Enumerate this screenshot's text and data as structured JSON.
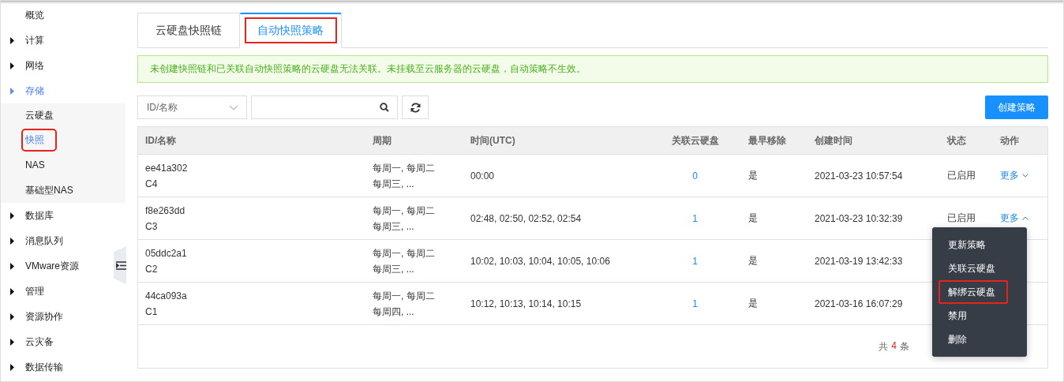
{
  "sidebar": {
    "items": [
      {
        "label": "概览",
        "has_arrow": false,
        "expanded": false
      },
      {
        "label": "计算",
        "has_arrow": true,
        "expanded": false
      },
      {
        "label": "网络",
        "has_arrow": true,
        "expanded": false
      },
      {
        "label": "存储",
        "has_arrow": true,
        "expanded": true,
        "children": [
          {
            "label": "云硬盘",
            "selected": false,
            "highlighted": false
          },
          {
            "label": "快照",
            "selected": true,
            "highlighted": true
          },
          {
            "label": "NAS",
            "selected": false,
            "highlighted": false
          },
          {
            "label": "基础型NAS",
            "selected": false,
            "highlighted": false
          }
        ]
      },
      {
        "label": "数据库",
        "has_arrow": true,
        "expanded": false
      },
      {
        "label": "消息队列",
        "has_arrow": true,
        "expanded": false
      },
      {
        "label": "VMware资源",
        "has_arrow": true,
        "expanded": false
      },
      {
        "label": "管理",
        "has_arrow": true,
        "expanded": false
      },
      {
        "label": "资源协作",
        "has_arrow": true,
        "expanded": false
      },
      {
        "label": "云灾备",
        "has_arrow": true,
        "expanded": false
      },
      {
        "label": "数据传输",
        "has_arrow": true,
        "expanded": false
      }
    ]
  },
  "tabs": [
    {
      "label": "云硬盘快照链",
      "selected": false,
      "highlighted": false
    },
    {
      "label": "自动快照策略",
      "selected": true,
      "highlighted": true
    }
  ],
  "alert": {
    "text": "未创建快照链和已关联自动快照策略的云硬盘无法关联。未挂载至云服务器的云硬盘，自动策略不生效。"
  },
  "toolbar": {
    "filter_select": "ID/名称",
    "create_button": "创建策略"
  },
  "table": {
    "columns": [
      "ID/名称",
      "周期",
      "时间(UTC)",
      "关联云硬盘",
      "最早移除",
      "创建时间",
      "状态",
      "动作"
    ],
    "rows": [
      {
        "id": "ee41a302",
        "name": "C4",
        "period": [
          "每周一, 每周二",
          "每周三, ..."
        ],
        "time": "00:00",
        "linked": "0",
        "earliest_remove": "是",
        "created": "2021-03-23 10:57:54",
        "status": "已启用",
        "action": "更多",
        "expanded": false
      },
      {
        "id": "f8e263dd",
        "name": "C3",
        "period": [
          "每周一, 每周二",
          "每周三, ..."
        ],
        "time": "02:48, 02:50, 02:52, 02:54",
        "linked": "1",
        "earliest_remove": "是",
        "created": "2021-03-23 10:32:39",
        "status": "已启用",
        "action": "更多",
        "expanded": true
      },
      {
        "id": "05ddc2a1",
        "name": "C2",
        "period": [
          "每周一, 每周二",
          "每周三, ..."
        ],
        "time": "10:02, 10:03, 10:04, 10:05, 10:06",
        "linked": "1",
        "earliest_remove": "是",
        "created": "2021-03-19 13:42:33"
      },
      {
        "id": "44ca093a",
        "name": "C1",
        "period": [
          "每周一, 每周二",
          "每周四, ..."
        ],
        "time": "10:12, 10:13, 10:14, 10:15",
        "linked": "1",
        "earliest_remove": "是",
        "created": "2021-03-16 16:07:29"
      }
    ]
  },
  "pagination": {
    "total_prefix": "共",
    "total_count": "4",
    "total_suffix": "条"
  },
  "dropdown_menu": {
    "items": [
      {
        "label": "更新策略",
        "highlighted": false
      },
      {
        "label": "关联云硬盘",
        "highlighted": false
      },
      {
        "label": "解绑云硬盘",
        "highlighted": true
      },
      {
        "label": "禁用",
        "highlighted": false
      },
      {
        "label": "删除",
        "highlighted": false
      }
    ]
  }
}
